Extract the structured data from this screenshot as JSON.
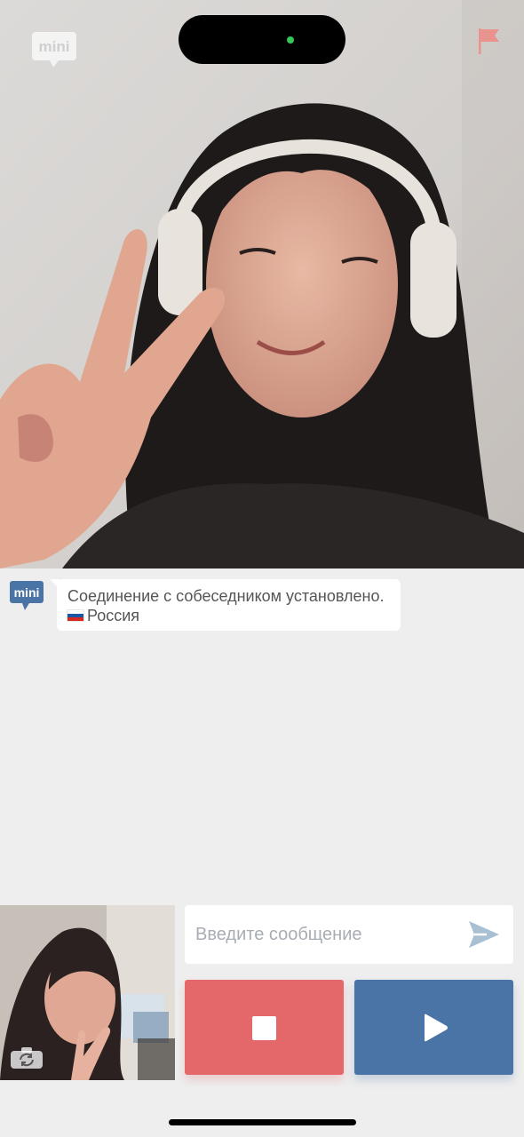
{
  "app": {
    "logo_text": "mini"
  },
  "chat": {
    "message_text": "Соединение с собеседником установлено.",
    "country_label": "Россия"
  },
  "composer": {
    "placeholder": "Введите сообщение"
  },
  "colors": {
    "background": "#eeeeee",
    "logo_blue": "#4a74a6",
    "stop_button": "#e4686a",
    "next_button": "#4a74a6",
    "report_flag": "#e9938f",
    "camera_indicator": "#34c759"
  },
  "icons": {
    "report": "flag-icon",
    "send": "send-icon",
    "stop": "stop-icon",
    "next": "play-icon",
    "switch_camera": "switch-camera-icon"
  }
}
